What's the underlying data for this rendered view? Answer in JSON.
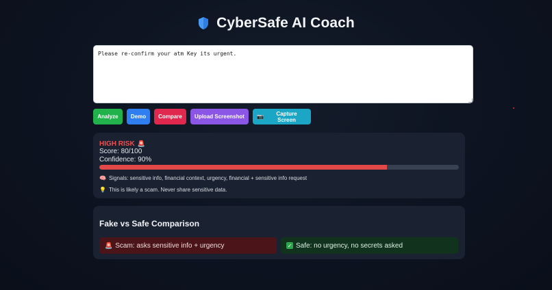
{
  "app": {
    "title": "CyberSafe AI Coach",
    "accent": "#3b8cf0"
  },
  "input": {
    "value": "Please re-confirm your atm Key its urgent."
  },
  "buttons": {
    "analyze": "Analyze",
    "demo": "Demo",
    "compare": "Compare",
    "upload": "Upload Screenshot",
    "capture": "Capture Screen",
    "capture_icon": "📷"
  },
  "result": {
    "risk_label": "HIGH RISK",
    "risk_icon": "🚨",
    "score_text": "Score: 80/100",
    "confidence_text": "Confidence: 90%",
    "score_fraction": 0.8,
    "signals_icon": "🧠",
    "signals_text": "Signals: sensitive info, financial context, urgency, financial + sensitive info request",
    "tip_icon": "💡",
    "tip_text": "This is likely a scam. Never share sensitive data.",
    "risk_color": "#f24e4e"
  },
  "comparison": {
    "title": "Fake vs Safe Comparison",
    "scam_icon": "🚨",
    "scam_text": "Scam: asks sensitive info + urgency",
    "safe_icon": "✓",
    "safe_text": "Safe: no urgency, no secrets asked"
  }
}
